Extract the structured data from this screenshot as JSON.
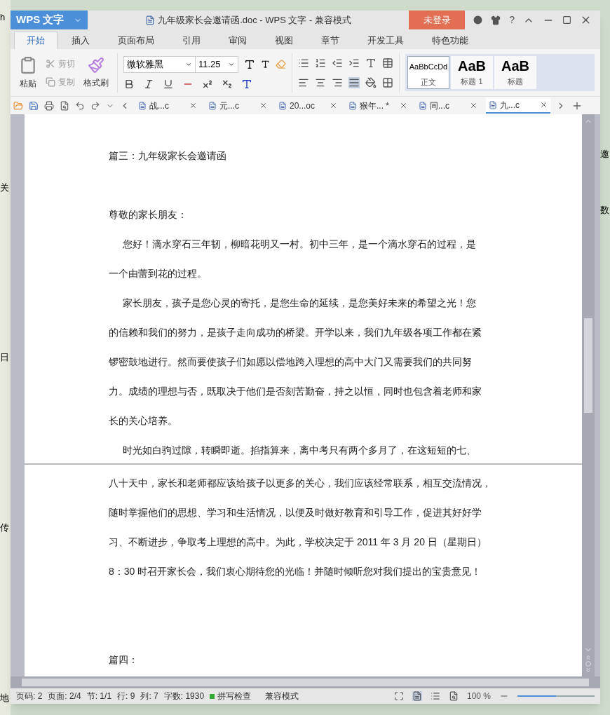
{
  "background": {
    "left_texts": [
      "h",
      "关",
      "日",
      "传",
      "地"
    ],
    "right_texts": [
      "邀",
      "数"
    ]
  },
  "window": {
    "app_button": "WPS 文字",
    "title": "九年级家长会邀请函.doc - WPS 文字 - 兼容模式",
    "login_button": "未登录",
    "help": "?"
  },
  "ribbon_tabs": [
    {
      "label": "开始",
      "selected": true
    },
    {
      "label": "插入",
      "selected": false
    },
    {
      "label": "页面布局",
      "selected": false
    },
    {
      "label": "引用",
      "selected": false
    },
    {
      "label": "审阅",
      "selected": false
    },
    {
      "label": "视图",
      "selected": false
    },
    {
      "label": "章节",
      "selected": false
    },
    {
      "label": "开发工具",
      "selected": false
    },
    {
      "label": "特色功能",
      "selected": false
    }
  ],
  "clipboard": {
    "paste": "粘贴",
    "cut": "剪切",
    "copy": "复制",
    "format_painter": "格式刷"
  },
  "font": {
    "name": "微软雅黑",
    "size": "11.25"
  },
  "styles": [
    {
      "sample": "AaBbCcDd",
      "label": "正文",
      "selected": true,
      "kind": "normal"
    },
    {
      "sample": "AaB",
      "label": "标题 1",
      "selected": false,
      "kind": "heading"
    },
    {
      "sample": "AaB",
      "label": "标题",
      "selected": false,
      "kind": "heading"
    }
  ],
  "doc_tabs": [
    {
      "label": "战...c",
      "selected": false
    },
    {
      "label": "元...c",
      "selected": false
    },
    {
      "label": "20...oc",
      "selected": false
    },
    {
      "label": "猴年... *",
      "selected": false
    },
    {
      "label": "同...c",
      "selected": false
    },
    {
      "label": "九...c",
      "selected": true
    }
  ],
  "pages": [
    {
      "blocks": [
        {
          "kind": "plain",
          "lines": [
            "篇三：九年级家长会邀请函"
          ]
        },
        {
          "kind": "blank"
        },
        {
          "kind": "plain",
          "lines": [
            "尊敬的家长朋友："
          ]
        },
        {
          "kind": "indented",
          "lines": [
            "您好！滴水穿石三年韧，柳暗花明又一村。初中三年，是一个滴水穿石的过程，是",
            "一个由蕾到花的过程。"
          ]
        },
        {
          "kind": "indented",
          "lines": [
            "家长朋友，孩子是您心灵的寄托，是您生命的延续，是您美好未来的希望之光！您",
            "的信赖和我们的努力，是孩子走向成功的桥梁。开学以来，我们九年级各项工作都在紧",
            "锣密鼓地进行。然而要使孩子们如愿以偿地跨入理想的高中大门又需要我们的共同努",
            "力。成绩的理想与否，既取决于他们是否刻苦勤奋，持之以恒，同时也包含着老师和家",
            "长的关心培养。"
          ]
        },
        {
          "kind": "indented",
          "lines": [
            "时光如白驹过隙，转瞬即逝。掐指算来，离中考只有两个多月了，在这短短的七、"
          ]
        }
      ]
    },
    {
      "blocks": [
        {
          "kind": "plain",
          "lines": [
            "八十天中，家长和老师都应该给孩子以更多的关心，我们应该经常联系，相互交流情况，",
            "随时掌握他们的思想、学习和生活情况，以便及时做好教育和引导工作，促进其好好学",
            "习、不断进步，争取考上理想的高中。为此，学校决定于 2011 年 3 月 20 日（星期日）",
            "8：30 时召开家长会，我们衷心期待您的光临！并随时倾听您对我们提出的宝贵意见！"
          ]
        },
        {
          "kind": "blank"
        },
        {
          "kind": "blank"
        },
        {
          "kind": "plain",
          "lines": [
            "篇四："
          ]
        }
      ]
    }
  ],
  "status_bar": {
    "items": [
      "页码: 2",
      "页面: 2/4",
      "节: 1/1",
      "行: 9",
      "列: 7",
      "字数: 1930"
    ],
    "spell_check": "拼写检查",
    "mode": "兼容模式",
    "zoom": "100 %",
    "zoom_level": {
      "level": 0.5
    }
  }
}
